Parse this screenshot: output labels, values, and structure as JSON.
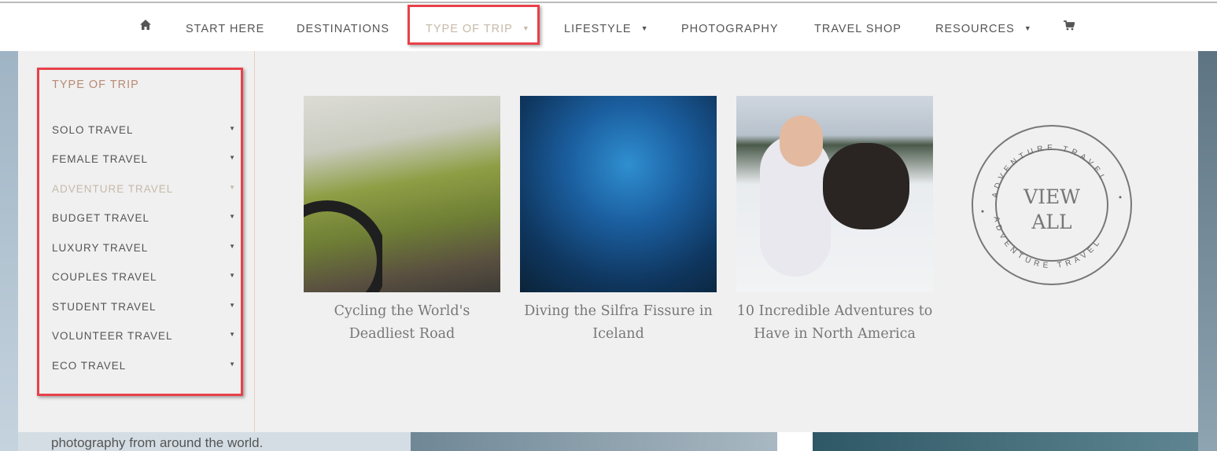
{
  "nav": {
    "items": [
      {
        "label": "",
        "icon": "home-icon"
      },
      {
        "label": "START HERE"
      },
      {
        "label": "DESTINATIONS"
      },
      {
        "label": "TYPE OF TRIP",
        "dropdown": true,
        "active": true
      },
      {
        "label": "LIFESTYLE",
        "dropdown": true
      },
      {
        "label": "PHOTOGRAPHY"
      },
      {
        "label": "TRAVEL SHOP"
      },
      {
        "label": "RESOURCES",
        "dropdown": true
      },
      {
        "label": "",
        "icon": "cart-icon"
      }
    ]
  },
  "dropdown": {
    "title": "TYPE OF TRIP",
    "items": [
      "SOLO TRAVEL",
      "FEMALE TRAVEL",
      "ADVENTURE TRAVEL",
      "BUDGET TRAVEL",
      "LUXURY TRAVEL",
      "COUPLES TRAVEL",
      "STUDENT TRAVEL",
      "VOLUNTEER TRAVEL",
      "ECO TRAVEL"
    ],
    "active_item": "ADVENTURE TRAVEL",
    "posts": [
      {
        "title_line1": "Cycling the World's",
        "title_line2": "Deadliest Road"
      },
      {
        "title_line1": "Diving the Silfra Fissure in",
        "title_line2": "Iceland"
      },
      {
        "title_line1": "10 Incredible Adventures to",
        "title_line2": "Have in North America"
      }
    ],
    "view_all": {
      "line1": "VIEW",
      "line2": "ALL",
      "ring_text": "ADVENTURE TRAVEL"
    }
  },
  "background": {
    "text": "photography from around the world."
  },
  "colors": {
    "accent": "#b98a75",
    "active": "#c6b9a9",
    "highlight": "#e8414a",
    "panel": "#f0f0f0"
  }
}
